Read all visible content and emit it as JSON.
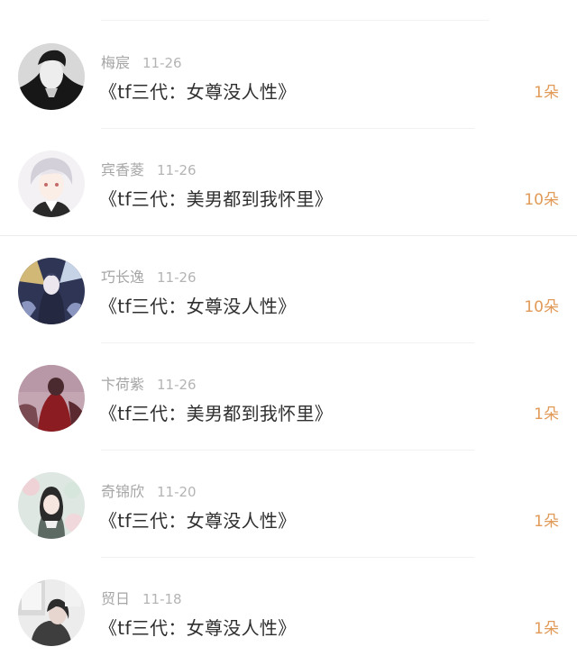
{
  "items": [
    {
      "user": "梅宸",
      "time": "11-26",
      "title": "《tf三代：女尊没人性》",
      "gift": "1朵",
      "avatar_icon": "man-avatar-icon"
    },
    {
      "user": "宾香菱",
      "time": "11-26",
      "title": "《tf三代：美男都到我怀里》",
      "gift": "10朵",
      "avatar_icon": "anime-boy-avatar-icon"
    },
    {
      "user": "巧长逸",
      "time": "11-26",
      "title": "《tf三代：女尊没人性》",
      "gift": "10朵",
      "avatar_icon": "anime-girl-avatar-icon"
    },
    {
      "user": "卞荷紫",
      "time": "11-26",
      "title": "《tf三代：美男都到我怀里》",
      "gift": "1朵",
      "avatar_icon": "photo-avatar-icon"
    },
    {
      "user": "奇锦欣",
      "time": "11-20",
      "title": "《tf三代：女尊没人性》",
      "gift": "1朵",
      "avatar_icon": "girl-photo-avatar-icon"
    },
    {
      "user": "贸日",
      "time": "11-18",
      "title": "《tf三代：女尊没人性》",
      "gift": "1朵",
      "avatar_icon": "room-photo-avatar-icon"
    }
  ]
}
